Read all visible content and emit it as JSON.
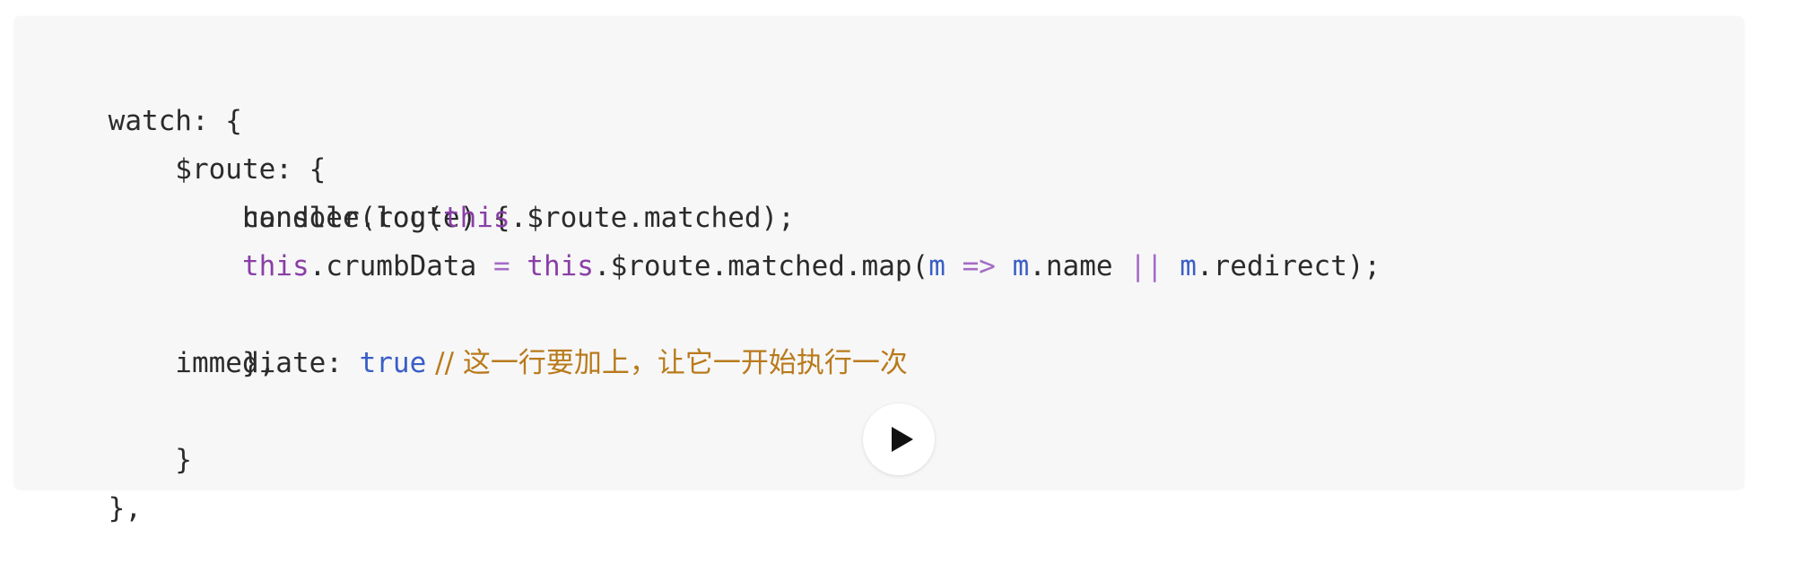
{
  "code": {
    "line1": {
      "text": "watch: {"
    },
    "line2": {
      "text": "    $route: {"
    },
    "line3": {
      "text": "        handler(route) {"
    },
    "line4": {
      "t1": "            console.log(",
      "t2": "this",
      "t3": ".$route.matched);"
    },
    "line5": {
      "t1": "            ",
      "t2": "this",
      "t3": ".crumbData ",
      "t4": "=",
      "t5": " ",
      "t6": "this",
      "t7": ".$route.matched.map(",
      "t8": "m",
      "t9": " ",
      "t10": "=>",
      "t11": " ",
      "t12": "m",
      "t13": ".name ",
      "t14": "||",
      "t15": " ",
      "t16": "m",
      "t17": ".redirect);"
    },
    "line6": {
      "text": "        },"
    },
    "line7": {
      "t1": "        immediate: ",
      "t2": "true",
      "t3": " // 这一行要加上，让它一开始执行一次"
    },
    "line8": {
      "text": "    }"
    },
    "line9": {
      "text": "},"
    }
  },
  "controls": {
    "play_icon": "play-icon"
  },
  "colors": {
    "keyword": "#8a3fa5",
    "operator": "#a46cc6",
    "param": "#3a5fc4",
    "comment": "#b97a1b",
    "text": "#2b2b2b",
    "background": "#f7f7f8"
  }
}
